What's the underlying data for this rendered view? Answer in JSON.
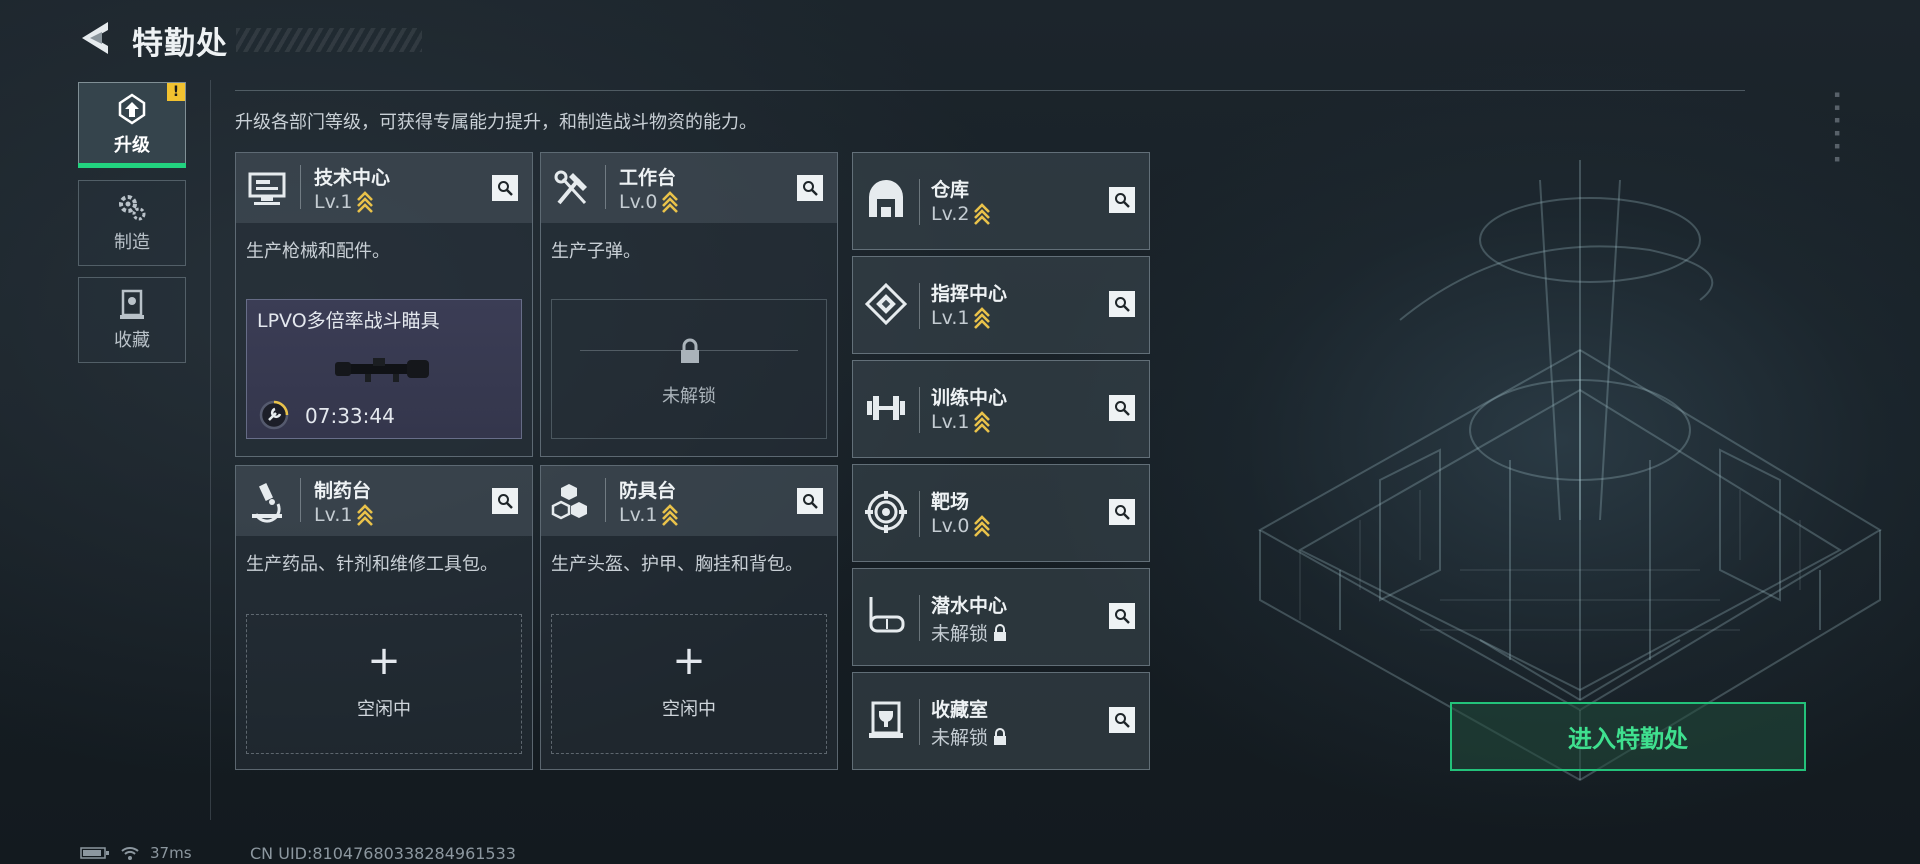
{
  "header": {
    "title": "特勤处",
    "back_icon": "back-arrow-icon"
  },
  "nav": {
    "tabs": [
      {
        "label": "升级",
        "icon": "upgrade-icon",
        "active": true,
        "badge": "!"
      },
      {
        "label": "制造",
        "icon": "gears-icon",
        "active": false
      },
      {
        "label": "收藏",
        "icon": "collection-icon",
        "active": false
      }
    ]
  },
  "intro": "升级各部门等级，可获得专属能力提升，和制造战斗物资的能力。",
  "departments_large": [
    {
      "name": "技术中心",
      "level": "Lv.1",
      "icon": "monitor-icon",
      "desc": "生产枪械和配件。",
      "production": {
        "item": "LPVO多倍率战斗瞄具",
        "timer": "07:33:44",
        "image": "rifle-scope-image"
      }
    },
    {
      "name": "工作台",
      "level": "Lv.0",
      "icon": "tools-icon",
      "desc": "生产子弹。",
      "locked_text": "未解锁"
    },
    {
      "name": "制药台",
      "level": "Lv.1",
      "icon": "microscope-icon",
      "desc": "生产药品、针剂和维修工具包。",
      "idle_text": "空闲中"
    },
    {
      "name": "防具台",
      "level": "Lv.1",
      "icon": "armor-boxes-icon",
      "desc": "生产头盔、护甲、胸挂和背包。",
      "idle_text": "空闲中"
    }
  ],
  "departments_small": [
    {
      "name": "仓库",
      "level": "Lv.2",
      "icon": "warehouse-icon",
      "locked": false
    },
    {
      "name": "指挥中心",
      "level": "Lv.1",
      "icon": "command-icon",
      "locked": false
    },
    {
      "name": "训练中心",
      "level": "Lv.1",
      "icon": "dumbbell-icon",
      "locked": false
    },
    {
      "name": "靶场",
      "level": "Lv.0",
      "icon": "target-icon",
      "locked": false
    },
    {
      "name": "潜水中心",
      "level": "未解锁",
      "icon": "diving-mask-icon",
      "locked": true
    },
    {
      "name": "收藏室",
      "level": "未解锁",
      "icon": "trophy-case-icon",
      "locked": true
    }
  ],
  "enter_button": "进入特勤处",
  "status": {
    "ping": "37ms",
    "uid": "CN UID:810476803382849615​33"
  },
  "colors": {
    "accent_green": "#22d37f",
    "rank_gold": "#e9c24a",
    "bg": "#1a2329"
  }
}
